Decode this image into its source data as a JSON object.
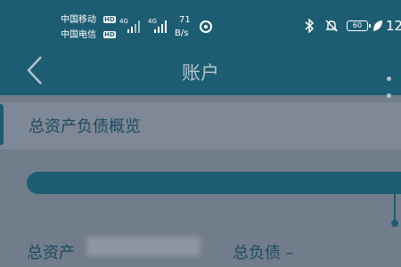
{
  "status_bar": {
    "carrier1": "中国移动",
    "carrier2": "中国电信",
    "hd_badge": "HD",
    "network1": "4G",
    "network2": "4G",
    "speed_value": "71",
    "speed_unit": "B/s",
    "battery": "60",
    "time": "12"
  },
  "header": {
    "title": "账户"
  },
  "section": {
    "title": "总资产负债概览"
  },
  "summary": {
    "total_assets_label": "总资产",
    "total_liabilities": "总负债 –"
  },
  "colors": {
    "brand": "#1d5d73",
    "overlay_bg": "#727d8b",
    "title_dim": "#b3c3cc"
  },
  "icons": [
    "back-arrow-icon",
    "more-icon",
    "bluetooth-icon",
    "mute-bell-icon",
    "leaf-icon",
    "nfc-icon",
    "signal-icon"
  ]
}
